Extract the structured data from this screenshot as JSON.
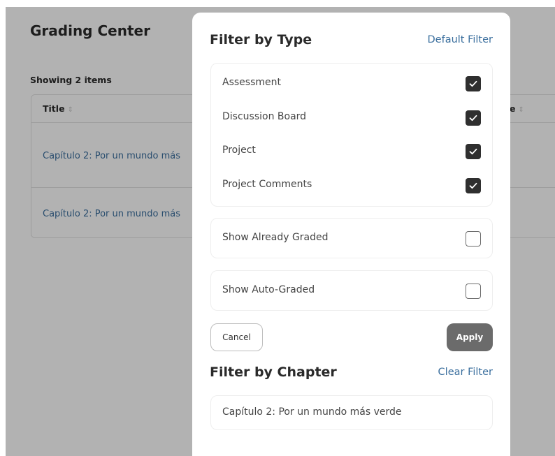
{
  "background": {
    "title": "Grading Center",
    "showing": "Showing 2 items",
    "table": {
      "columns": [
        {
          "label": "Title",
          "sort_glyph": "⇕"
        },
        {
          "label": "e",
          "sort_glyph": "⇕"
        }
      ],
      "rows": [
        {
          "title": "Capítulo 2: Por un mundo más"
        },
        {
          "title": "Capítulo 2: Por un mundo más"
        }
      ]
    }
  },
  "modal": {
    "filter_type": {
      "title": "Filter by Type",
      "link": "Default Filter",
      "options": [
        {
          "label": "Assessment",
          "checked": true
        },
        {
          "label": "Discussion Board",
          "checked": true
        },
        {
          "label": "Project",
          "checked": true
        },
        {
          "label": "Project Comments",
          "checked": true
        }
      ],
      "show_graded": {
        "label": "Show Already Graded",
        "checked": false
      },
      "show_auto": {
        "label": "Show Auto-Graded",
        "checked": false
      }
    },
    "buttons": {
      "cancel": "Cancel",
      "apply": "Apply"
    },
    "filter_chapter": {
      "title": "Filter by Chapter",
      "link": "Clear Filter",
      "value": "Capítulo 2: Por un mundo más verde"
    }
  },
  "colors": {
    "link": "#3b6f9e",
    "checkbox_checked": "#2f2f2f",
    "apply_button": "#6b6b6b",
    "overlay": "rgba(0,0,0,0.30)"
  },
  "icons": {
    "sort": "sort-icon",
    "check": "check-icon"
  }
}
